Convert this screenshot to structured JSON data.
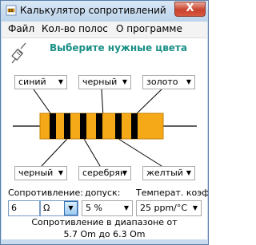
{
  "window": {
    "title": "Калькулятор сопротивлений",
    "close_symbol": "X"
  },
  "menu": {
    "items": [
      {
        "label": "Файл"
      },
      {
        "label": "Кол-во полос"
      },
      {
        "label": "О программе"
      }
    ]
  },
  "heading": "Выберите нужные цвета",
  "top_bands": {
    "band1": "синий",
    "band2": "черный",
    "band3": "золото"
  },
  "bottom_bands": {
    "band1": "черный",
    "band2": "серебрян",
    "band3": "желтый"
  },
  "labels": {
    "resistance": "Сопротивление:",
    "tolerance": "допуск:",
    "tempco": "Температ. коэф.:"
  },
  "fields": {
    "resistance_value": "6",
    "unit": "Ω",
    "tolerance": "5 %",
    "tempco": "25 ppm/°C"
  },
  "result": {
    "line1": "Сопротивление в диапазоне от",
    "line2": "5.7 Om до 6.3 Om"
  },
  "colors": {
    "resistor_body": "#f5a818",
    "band": "#000000",
    "heading": "#1a8f86"
  },
  "icons": [
    "app-icon",
    "probe-icon",
    "dropdown-arrow-icon",
    "close-icon"
  ]
}
